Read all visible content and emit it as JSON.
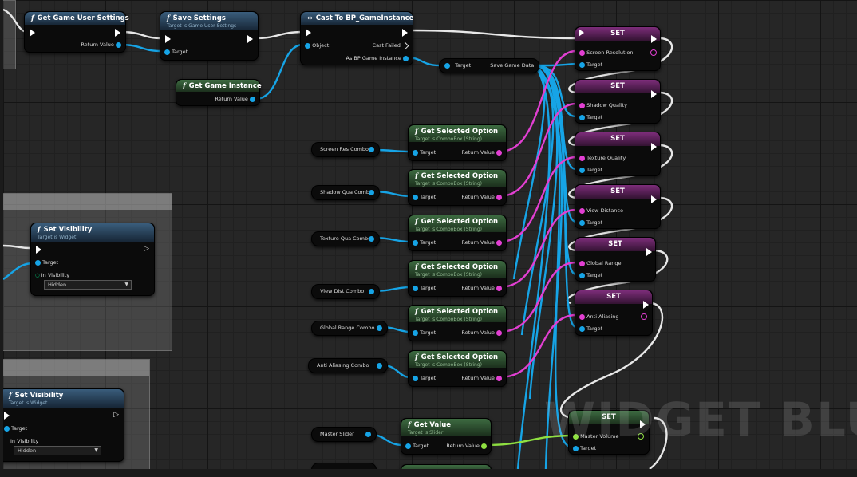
{
  "graph": {
    "watermark": "WIDGET BLUE"
  },
  "nodes": {
    "get_user_settings": {
      "title": "Get Game User Settings",
      "return_value": "Return Value"
    },
    "save_settings": {
      "title": "Save Settings",
      "subtitle": "Target is Game User Settings",
      "target": "Target"
    },
    "get_game_instance": {
      "title": "Get Game Instance",
      "return_value": "Return Value"
    },
    "cast": {
      "title": "Cast To BP_GameInstance",
      "object": "Object",
      "cast_failed": "Cast Failed",
      "as_instance": "As BP Game Instance"
    },
    "save_game_data": {
      "target": "Target",
      "label": "Save Game Data"
    },
    "get_selected_option": {
      "title": "Get Selected Option",
      "subtitle": "Target is ComboBox (String)",
      "target": "Target",
      "return_value": "Return Value"
    },
    "get_value": {
      "title": "Get Value",
      "subtitle": "Target is Slider",
      "target": "Target",
      "return_value": "Return Value"
    },
    "set_visibility": {
      "title": "Set Visibility",
      "subtitle": "Target is Widget",
      "target": "Target",
      "in_visibility": "In Visibility",
      "option": "Hidden"
    }
  },
  "combo_variables": [
    "Screen Res Combo",
    "Shadow Qua Combo",
    "Texture Qua Combo",
    "View Dist Combo",
    "Global Range Combo",
    "Anti Aliasing Combo"
  ],
  "slider_variable": "Master Slider",
  "set_nodes": {
    "title": "SET",
    "target": "Target",
    "items": [
      "Screen Resolution",
      "Shadow Quality",
      "Texture Quality",
      "View Distance",
      "Global Range",
      "Anti Aliasing",
      "Master Volume"
    ]
  },
  "colors": {
    "exec": "#ffffff",
    "object_pin": "#16a4e6",
    "string_pin": "#e23fd2",
    "float_pin": "#8fe041",
    "function_header": "#3a5d7c",
    "pure_function_header": "#3d6b41",
    "set_header": "#7d2d7a"
  }
}
